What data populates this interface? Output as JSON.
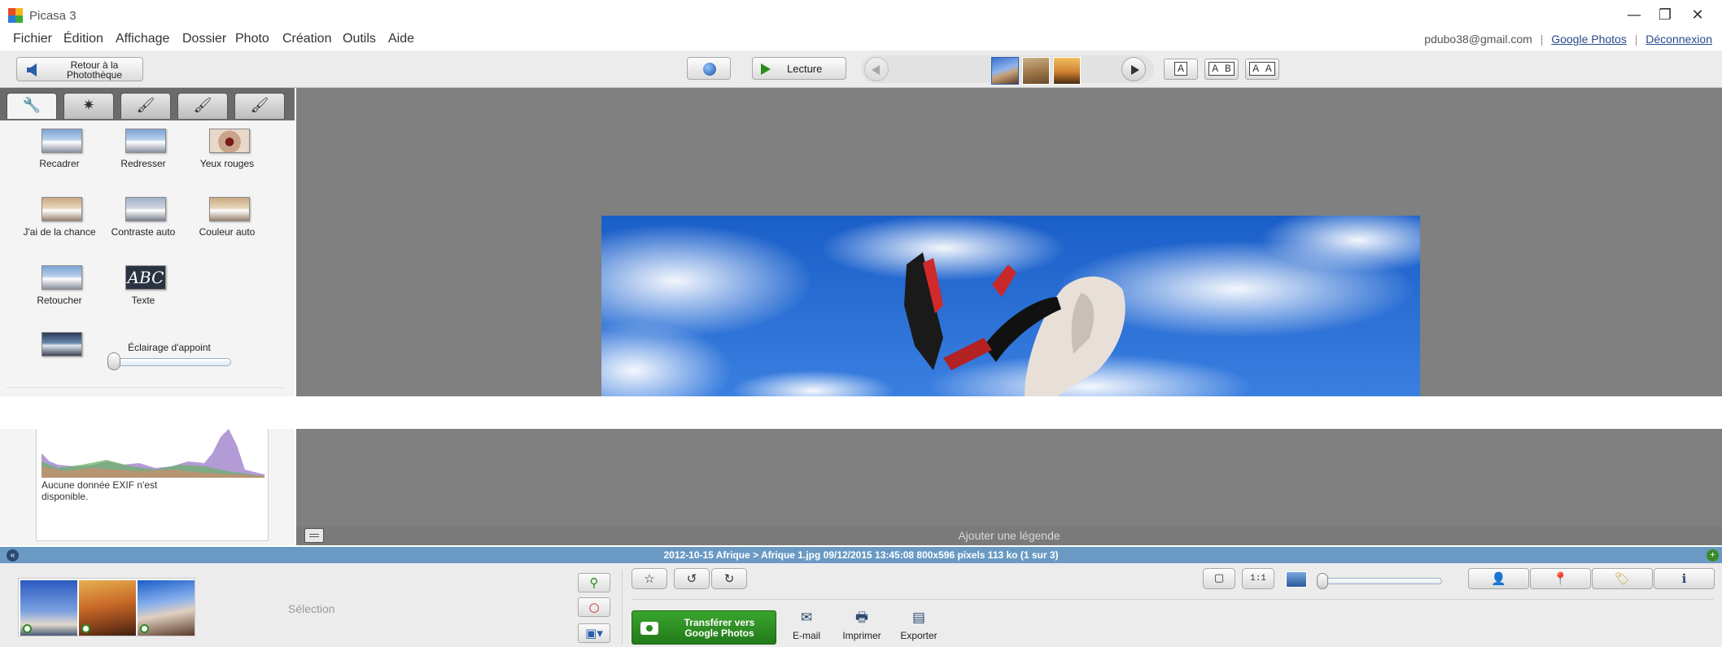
{
  "window": {
    "title": "Picasa 3",
    "minimize_glyph": "—",
    "restore_glyph": "❐",
    "close_glyph": "✕"
  },
  "menu": [
    {
      "id": "fichier",
      "label": "Fichier"
    },
    {
      "id": "edition",
      "label": "Édition"
    },
    {
      "id": "affichage",
      "label": "Affichage"
    },
    {
      "id": "dossier",
      "label": "Dossier"
    },
    {
      "id": "photo",
      "label": "Photo"
    },
    {
      "id": "creation",
      "label": "Création"
    },
    {
      "id": "outils",
      "label": "Outils"
    },
    {
      "id": "aide",
      "label": "Aide"
    }
  ],
  "account": {
    "email": "pdubo38@gmail.com",
    "separator": "|",
    "google_photos": "Google Photos",
    "logout": "Déconnexion"
  },
  "toolbar": {
    "back_label_line1": "Retour à la",
    "back_label_line2": "Photothèque",
    "play_label": "Lecture",
    "compare_a": "A",
    "compare_ab": "A B",
    "compare_aa": "A A"
  },
  "tabs": [
    {
      "id": "basic-fixes",
      "icon": "wrench-icon",
      "glyph": "🔧",
      "active": true
    },
    {
      "id": "tuning",
      "icon": "sun-icon",
      "glyph": "✷"
    },
    {
      "id": "effects",
      "icon": "brush-icon",
      "glyph": "🖌"
    },
    {
      "id": "effects-2",
      "icon": "brush-green-icon",
      "glyph": "🖌"
    },
    {
      "id": "effects-3",
      "icon": "brush-blue-icon",
      "glyph": "🖌"
    }
  ],
  "tools": {
    "crop": "Recadrer",
    "straighten": "Redresser",
    "red_eye": "Yeux rouges",
    "feeling_lucky": "J'ai de la chance",
    "auto_contrast": "Contraste auto",
    "auto_color": "Couleur auto",
    "retouch": "Retoucher",
    "text": "Texte",
    "text_icon_label": "ABC",
    "fill_light": "Éclairage d'appoint",
    "fill_light_value": 0
  },
  "exif": {
    "message": "Aucune donnée EXIF n'est disponible."
  },
  "viewer": {
    "caption_placeholder": "Ajouter une légende"
  },
  "status": {
    "text": "2012-10-15 Afrique > Afrique 1.jpg    09/12/2015 13:45:08    800x596 pixels    113 ko   (1 sur 3)",
    "collapse_glyph": "«",
    "expand_glyph": "+"
  },
  "tray": {
    "selection_label": "Sélection",
    "upload_label_line1": "Transférer vers",
    "upload_label_line2": "Google Photos",
    "email": "E-mail",
    "print": "Imprimer",
    "export": "Exporter",
    "star_glyph": "☆",
    "rotate_left_glyph": "↺",
    "rotate_right_glyph": "↻",
    "fit_glyph": "▢",
    "actual_size_label": "1:1",
    "zoom_value": 0
  },
  "colors": {
    "status_bar": "#6a9ac4",
    "upload_green": "#2d8a1f",
    "viewer_bg": "#808080"
  }
}
